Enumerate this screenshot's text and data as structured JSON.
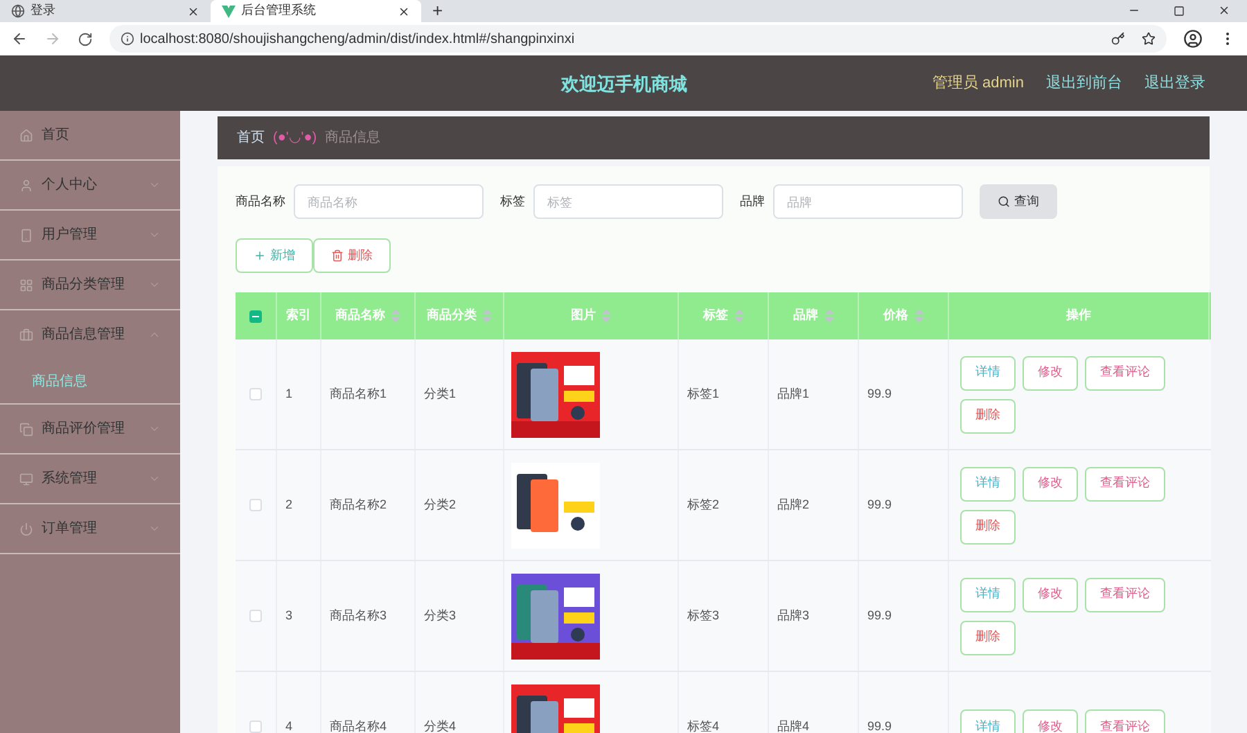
{
  "browser": {
    "tabs": [
      {
        "title": "登录",
        "selected": false
      },
      {
        "title": "后台管理系统",
        "selected": true
      }
    ],
    "new_tab": "+",
    "url": "localhost:8080/shoujishangcheng/admin/dist/index.html#/shangpinxinxi"
  },
  "header": {
    "title": "欢迎迈手机商城",
    "user": "管理员 admin",
    "links": [
      "退出到前台",
      "退出登录"
    ]
  },
  "sidebar": {
    "items": [
      {
        "label": "首页",
        "expandable": false,
        "expanded": false
      },
      {
        "label": "个人中心",
        "expandable": true,
        "expanded": false
      },
      {
        "label": "用户管理",
        "expandable": true,
        "expanded": false
      },
      {
        "label": "商品分类管理",
        "expandable": true,
        "expanded": false
      },
      {
        "label": "商品信息管理",
        "expandable": true,
        "expanded": true,
        "children": [
          {
            "label": "商品信息",
            "selected": true
          }
        ]
      },
      {
        "label": "商品评价管理",
        "expandable": true,
        "expanded": false
      },
      {
        "label": "系统管理",
        "expandable": true,
        "expanded": false
      },
      {
        "label": "订单管理",
        "expandable": true,
        "expanded": false
      }
    ]
  },
  "breadcrumb": {
    "home": "首页",
    "separator": "(●'◡'●)",
    "current": "商品信息"
  },
  "search": {
    "fields": [
      {
        "label": "商品名称",
        "placeholder": "商品名称"
      },
      {
        "label": "标签",
        "placeholder": "标签"
      },
      {
        "label": "品牌",
        "placeholder": "品牌"
      }
    ],
    "button": "查询"
  },
  "toolbar": [
    {
      "label": "新增",
      "kind": "add"
    },
    {
      "label": "删除",
      "kind": "delete"
    }
  ],
  "table": {
    "header_checkbox": {
      "indeterminate": true
    },
    "columns": [
      {
        "label": "索引",
        "sortable": false
      },
      {
        "label": "商品名称",
        "sortable": true
      },
      {
        "label": "商品分类",
        "sortable": true
      },
      {
        "label": "图片",
        "sortable": true
      },
      {
        "label": "标签",
        "sortable": true
      },
      {
        "label": "品牌",
        "sortable": true
      },
      {
        "label": "价格",
        "sortable": true
      },
      {
        "label": "操作",
        "sortable": false
      }
    ],
    "rows": [
      {
        "checked": false,
        "index": "1",
        "name": "商品名称1",
        "category": "分类1",
        "image": {
          "kind": "picture"
        },
        "tag": "标签1",
        "brand": "品牌1",
        "price": "99.9",
        "actions": [
          {
            "label": "详情",
            "kind": "info"
          },
          {
            "label": "修改",
            "kind": "edit"
          },
          {
            "label": "查看评论",
            "kind": "edit"
          },
          {
            "label": "删除",
            "kind": "delete"
          }
        ]
      },
      {
        "checked": false,
        "index": "2",
        "name": "商品名称2",
        "category": "分类2",
        "image": {
          "kind": "picture"
        },
        "tag": "标签2",
        "brand": "品牌2",
        "price": "99.9",
        "actions": [
          {
            "label": "详情",
            "kind": "info"
          },
          {
            "label": "修改",
            "kind": "edit"
          },
          {
            "label": "查看评论",
            "kind": "edit"
          },
          {
            "label": "删除",
            "kind": "delete"
          }
        ]
      },
      {
        "checked": false,
        "index": "3",
        "name": "商品名称3",
        "category": "分类3",
        "image": {
          "kind": "picture"
        },
        "tag": "标签3",
        "brand": "品牌3",
        "price": "99.9",
        "actions": [
          {
            "label": "详情",
            "kind": "info"
          },
          {
            "label": "修改",
            "kind": "edit"
          },
          {
            "label": "查看评论",
            "kind": "edit"
          },
          {
            "label": "删除",
            "kind": "delete"
          }
        ]
      },
      {
        "checked": false,
        "index": "4",
        "name": "商品名称4",
        "category": "分类4",
        "image": {
          "kind": "picture"
        },
        "tag": "标签4",
        "brand": "品牌4",
        "price": "99.9",
        "actions": [
          {
            "label": "详情",
            "kind": "info"
          },
          {
            "label": "修改",
            "kind": "edit"
          },
          {
            "label": "查看评论",
            "kind": "edit"
          }
        ]
      }
    ]
  }
}
